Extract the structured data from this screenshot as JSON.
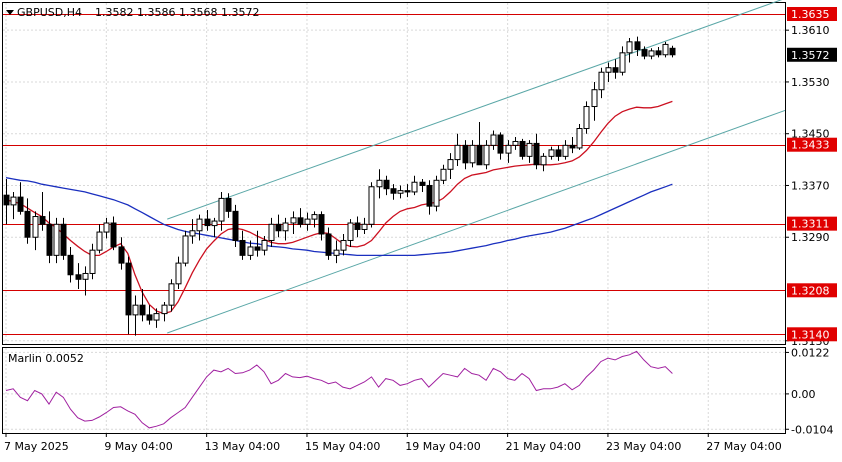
{
  "header": {
    "symbol": "GBPUSD,H4",
    "ohlc": "1.3582 1.3586 1.3568 1.3572"
  },
  "colors": {
    "candle": "#000000",
    "bull_fill": "#ffffff",
    "bear_fill": "#000000",
    "level_line": "#d40000",
    "level_label_bg": "#e00000",
    "channel": "#5aa7a7",
    "ma_fast": "#cc1020",
    "ma_slow": "#1a2fbf",
    "oscillator": "#a020a0",
    "grid": "#d9d9d9"
  },
  "chart_data": [
    {
      "type": "candlestick",
      "name": "price",
      "y_ticks": [
        "1.3610",
        "1.3530",
        "1.3450",
        "1.3370",
        "1.3290",
        "1.3130"
      ],
      "ylim": [
        1.3125,
        1.3652
      ],
      "current_price": "1.3572",
      "levels": [
        "1.3635",
        "1.3433",
        "1.3311",
        "1.3208",
        "1.3140"
      ],
      "x_labels": [
        "7 May 2025",
        "9 May 04:00",
        "13 May 04:00",
        "15 May 04:00",
        "19 May 04:00",
        "21 May 04:00",
        "23 May 04:00",
        "27 May 04:00"
      ],
      "candles": [
        [
          1.3355,
          1.338,
          1.331,
          1.334
        ],
        [
          1.334,
          1.336,
          1.3318,
          1.3352
        ],
        [
          1.3352,
          1.3375,
          1.3325,
          1.333
        ],
        [
          1.333,
          1.335,
          1.328,
          1.329
        ],
        [
          1.329,
          1.333,
          1.327,
          1.3322
        ],
        [
          1.3322,
          1.336,
          1.33,
          1.331
        ],
        [
          1.331,
          1.333,
          1.325,
          1.3262
        ],
        [
          1.3262,
          1.332,
          1.325,
          1.331
        ],
        [
          1.331,
          1.332,
          1.3255,
          1.3262
        ],
        [
          1.3262,
          1.3275,
          1.322,
          1.3232
        ],
        [
          1.3232,
          1.325,
          1.321,
          1.3225
        ],
        [
          1.3225,
          1.3245,
          1.32,
          1.3234
        ],
        [
          1.3234,
          1.328,
          1.3225,
          1.327
        ],
        [
          1.327,
          1.331,
          1.3265,
          1.3298
        ],
        [
          1.3298,
          1.332,
          1.3288,
          1.3312
        ],
        [
          1.3312,
          1.3322,
          1.327,
          1.3275
        ],
        [
          1.3275,
          1.329,
          1.324,
          1.325
        ],
        [
          1.325,
          1.326,
          1.314,
          1.317
        ],
        [
          1.317,
          1.32,
          1.3138,
          1.3185
        ],
        [
          1.3185,
          1.321,
          1.316,
          1.317
        ],
        [
          1.317,
          1.3185,
          1.3155,
          1.3162
        ],
        [
          1.3162,
          1.318,
          1.315,
          1.3172
        ],
        [
          1.3172,
          1.319,
          1.316,
          1.3185
        ],
        [
          1.3185,
          1.3225,
          1.3175,
          1.3218
        ],
        [
          1.3218,
          1.326,
          1.321,
          1.325
        ],
        [
          1.325,
          1.33,
          1.3245,
          1.3292
        ],
        [
          1.3292,
          1.3318,
          1.328,
          1.33
        ],
        [
          1.33,
          1.3325,
          1.3285,
          1.3318
        ],
        [
          1.3318,
          1.3332,
          1.33,
          1.3308
        ],
        [
          1.3308,
          1.332,
          1.329,
          1.3315
        ],
        [
          1.3315,
          1.336,
          1.33,
          1.335
        ],
        [
          1.335,
          1.3358,
          1.332,
          1.333
        ],
        [
          1.333,
          1.334,
          1.3275,
          1.3285
        ],
        [
          1.3285,
          1.33,
          1.3255,
          1.3262
        ],
        [
          1.3262,
          1.3285,
          1.3255,
          1.3275
        ],
        [
          1.3275,
          1.33,
          1.326,
          1.327
        ],
        [
          1.327,
          1.3292,
          1.3262,
          1.3285
        ],
        [
          1.3285,
          1.332,
          1.3275,
          1.331
        ],
        [
          1.331,
          1.3325,
          1.329,
          1.33
        ],
        [
          1.33,
          1.332,
          1.3285,
          1.3312
        ],
        [
          1.3312,
          1.333,
          1.3295,
          1.332
        ],
        [
          1.332,
          1.3335,
          1.3305,
          1.331
        ],
        [
          1.331,
          1.3328,
          1.33,
          1.3318
        ],
        [
          1.3318,
          1.333,
          1.3305,
          1.3325
        ],
        [
          1.3325,
          1.333,
          1.3285,
          1.3295
        ],
        [
          1.3295,
          1.3305,
          1.3255,
          1.3262
        ],
        [
          1.3262,
          1.3285,
          1.325,
          1.327
        ],
        [
          1.327,
          1.3295,
          1.3262,
          1.3285
        ],
        [
          1.3285,
          1.3318,
          1.3275,
          1.3312
        ],
        [
          1.3312,
          1.3322,
          1.329,
          1.3302
        ],
        [
          1.3302,
          1.332,
          1.3295,
          1.331
        ],
        [
          1.331,
          1.3375,
          1.3305,
          1.3368
        ],
        [
          1.3368,
          1.3395,
          1.335,
          1.3378
        ],
        [
          1.3378,
          1.3385,
          1.3355,
          1.3365
        ],
        [
          1.3365,
          1.3372,
          1.3348,
          1.3358
        ],
        [
          1.3358,
          1.337,
          1.335,
          1.3362
        ],
        [
          1.3362,
          1.3372,
          1.3352,
          1.336
        ],
        [
          1.336,
          1.3385,
          1.3355,
          1.3375
        ],
        [
          1.3375,
          1.338,
          1.336,
          1.337
        ],
        [
          1.337,
          1.3378,
          1.3325,
          1.3338
        ],
        [
          1.3338,
          1.3385,
          1.333,
          1.3378
        ],
        [
          1.3378,
          1.3402,
          1.3372,
          1.3395
        ],
        [
          1.3395,
          1.342,
          1.338,
          1.341
        ],
        [
          1.341,
          1.345,
          1.34,
          1.3432
        ],
        [
          1.3432,
          1.344,
          1.3395,
          1.3405
        ],
        [
          1.3405,
          1.344,
          1.3398,
          1.3432
        ],
        [
          1.3432,
          1.3468,
          1.342,
          1.3402
        ],
        [
          1.3402,
          1.344,
          1.3395,
          1.3432
        ],
        [
          1.3432,
          1.3455,
          1.3425,
          1.3448
        ],
        [
          1.3448,
          1.3452,
          1.341,
          1.342
        ],
        [
          1.342,
          1.344,
          1.3405,
          1.3432
        ],
        [
          1.3432,
          1.3445,
          1.3425,
          1.3438
        ],
        [
          1.3438,
          1.3442,
          1.341,
          1.3415
        ],
        [
          1.3415,
          1.344,
          1.3405,
          1.3435
        ],
        [
          1.3435,
          1.345,
          1.3395,
          1.3402
        ],
        [
          1.3402,
          1.342,
          1.3392,
          1.3415
        ],
        [
          1.3415,
          1.343,
          1.341,
          1.3425
        ],
        [
          1.3425,
          1.3432,
          1.3408,
          1.3415
        ],
        [
          1.3415,
          1.344,
          1.341,
          1.3432
        ],
        [
          1.3432,
          1.3445,
          1.342,
          1.3428
        ],
        [
          1.3428,
          1.3465,
          1.3425,
          1.3458
        ],
        [
          1.3458,
          1.35,
          1.345,
          1.3492
        ],
        [
          1.3492,
          1.353,
          1.347,
          1.3518
        ],
        [
          1.3518,
          1.3552,
          1.3505,
          1.3545
        ],
        [
          1.3545,
          1.356,
          1.353,
          1.3552
        ],
        [
          1.3552,
          1.3565,
          1.3535,
          1.3545
        ],
        [
          1.3545,
          1.3585,
          1.354,
          1.3575
        ],
        [
          1.3575,
          1.3598,
          1.356,
          1.3592
        ],
        [
          1.3592,
          1.36,
          1.357,
          1.358
        ],
        [
          1.358,
          1.3585,
          1.3565,
          1.357
        ],
        [
          1.357,
          1.3582,
          1.3565,
          1.3578
        ],
        [
          1.3578,
          1.3584,
          1.3568,
          1.3572
        ],
        [
          1.3572,
          1.3592,
          1.3568,
          1.3588
        ],
        [
          1.3582,
          1.3586,
          1.3568,
          1.3572
        ]
      ],
      "ma_fast": [
        1.3348,
        1.3345,
        1.3342,
        1.3335,
        1.3328,
        1.3322,
        1.3312,
        1.3305,
        1.3295,
        1.3285,
        1.3276,
        1.3268,
        1.3262,
        1.3262,
        1.3268,
        1.3275,
        1.328,
        1.3265,
        1.3232,
        1.3205,
        1.3186,
        1.3176,
        1.3172,
        1.3175,
        1.319,
        1.3212,
        1.3235,
        1.3255,
        1.3272,
        1.3284,
        1.3295,
        1.3302,
        1.3304,
        1.3302,
        1.3298,
        1.3292,
        1.3287,
        1.3282,
        1.328,
        1.328,
        1.3282,
        1.3286,
        1.329,
        1.3294,
        1.3297,
        1.3296,
        1.3288,
        1.328,
        1.3276,
        1.3275,
        1.3278,
        1.3285,
        1.3298,
        1.3312,
        1.3322,
        1.333,
        1.3334,
        1.3336,
        1.334,
        1.3342,
        1.3344,
        1.335,
        1.336,
        1.3372,
        1.3381,
        1.3386,
        1.3388,
        1.339,
        1.3394,
        1.3396,
        1.3398,
        1.34,
        1.3401,
        1.3402,
        1.3403,
        1.3402,
        1.3402,
        1.3403,
        1.3405,
        1.3408,
        1.3414,
        1.3424,
        1.3437,
        1.3452,
        1.3466,
        1.3477,
        1.3484,
        1.3488,
        1.3491,
        1.349,
        1.349,
        1.3492,
        1.3496,
        1.35
      ],
      "ma_slow": [
        1.3382,
        1.338,
        1.3378,
        1.3377,
        1.3375,
        1.3372,
        1.337,
        1.3368,
        1.3366,
        1.3364,
        1.3362,
        1.336,
        1.3357,
        1.3354,
        1.3351,
        1.3348,
        1.3344,
        1.334,
        1.3334,
        1.3328,
        1.3322,
        1.3316,
        1.331,
        1.3306,
        1.3302,
        1.3299,
        1.3297,
        1.3295,
        1.3293,
        1.3291,
        1.3289,
        1.3287,
        1.3285,
        1.3283,
        1.3281,
        1.328,
        1.3278,
        1.3276,
        1.3275,
        1.3274,
        1.3272,
        1.3271,
        1.327,
        1.3268,
        1.3267,
        1.3266,
        1.3265,
        1.3264,
        1.3263,
        1.3262,
        1.3262,
        1.3262,
        1.3262,
        1.3262,
        1.3262,
        1.3262,
        1.3262,
        1.3262,
        1.3263,
        1.3264,
        1.3265,
        1.3266,
        1.3267,
        1.3269,
        1.3271,
        1.3273,
        1.3275,
        1.3277,
        1.328,
        1.3282,
        1.3285,
        1.3287,
        1.329,
        1.3292,
        1.3294,
        1.3296,
        1.3298,
        1.3301,
        1.3304,
        1.3308,
        1.3312,
        1.3316,
        1.332,
        1.3325,
        1.333,
        1.3335,
        1.334,
        1.3345,
        1.335,
        1.3355,
        1.336,
        1.3364,
        1.3368,
        1.3372
      ],
      "channel_upper": [
        [
          1.3318,
          1.3659
        ]
      ],
      "channel_lower": [
        [
          1.3142,
          1.3486
        ]
      ]
    },
    {
      "type": "line",
      "name": "Marlin",
      "label": "Marlin 0.0052",
      "y_ticks": [
        "0.0122",
        "0.00",
        "-0.0104"
      ],
      "ylim": [
        -0.0115,
        0.0135
      ],
      "values": [
        0.001,
        0.0015,
        -0.001,
        -0.002,
        0.001,
        0.0,
        -0.003,
        0.0005,
        -0.001,
        -0.0045,
        -0.007,
        -0.008,
        -0.0078,
        -0.0068,
        -0.0055,
        -0.004,
        -0.0038,
        -0.005,
        -0.006,
        -0.0085,
        -0.01,
        -0.0095,
        -0.0088,
        -0.007,
        -0.0055,
        -0.004,
        -0.001,
        0.002,
        0.005,
        0.007,
        0.0065,
        0.0075,
        0.006,
        0.0062,
        0.007,
        0.0085,
        0.0065,
        0.003,
        0.004,
        0.006,
        0.005,
        0.0048,
        0.0052,
        0.0045,
        0.004,
        0.003,
        0.0035,
        0.002,
        0.0015,
        0.0025,
        0.0035,
        0.005,
        0.002,
        0.0045,
        0.004,
        0.0025,
        0.003,
        0.004,
        0.0045,
        0.002,
        0.004,
        0.006,
        0.0055,
        0.005,
        0.0075,
        0.006,
        0.0055,
        0.004,
        0.0075,
        0.0065,
        0.0045,
        0.004,
        0.006,
        0.0045,
        0.001,
        0.0015,
        0.0015,
        0.002,
        0.003,
        0.0012,
        0.0025,
        0.005,
        0.007,
        0.0095,
        0.0105,
        0.01,
        0.011,
        0.0115,
        0.0125,
        0.01,
        0.008,
        0.0075,
        0.008,
        0.006
      ]
    }
  ]
}
